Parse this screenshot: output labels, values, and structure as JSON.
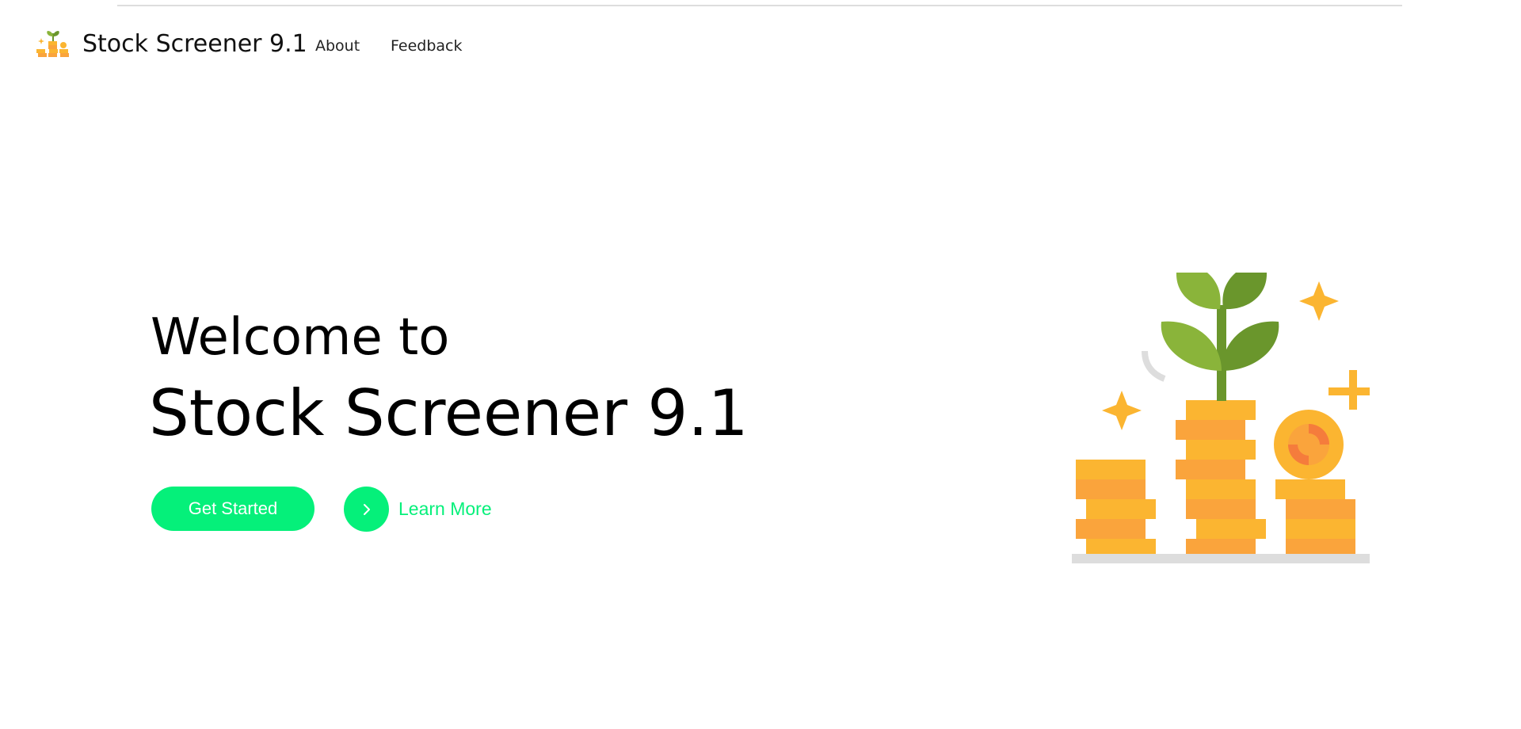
{
  "nav": {
    "brand_title": "Stock Screener 9.1",
    "links": [
      {
        "label": "About"
      },
      {
        "label": "Feedback"
      }
    ]
  },
  "hero": {
    "line1": "Welcome to",
    "line2": "Stock Screener 9.1",
    "primary_button": "Get Started",
    "secondary_link": "Learn More"
  },
  "icons": {
    "brand": "coin-stack-plant-icon",
    "learn_more": "chevron-right-icon",
    "illustration": "coin-stacks-plant-illustration"
  },
  "colors": {
    "accent": "#05f07a",
    "coin_light": "#fbb531",
    "coin_dark": "#faa43c",
    "leaf_light": "#8ab43a",
    "leaf_dark": "#6a962c"
  }
}
